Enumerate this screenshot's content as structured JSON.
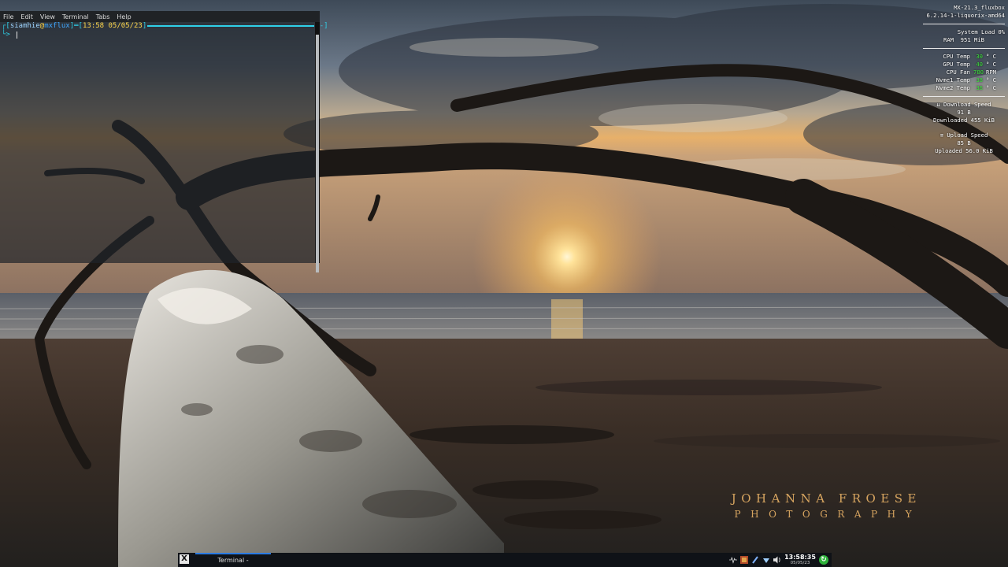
{
  "terminal": {
    "menu": [
      "File",
      "Edit",
      "View",
      "Terminal",
      "Tabs",
      "Help"
    ],
    "prompt": {
      "user": "siamhie",
      "at": "@",
      "host": "mxflux",
      "time": "13:58",
      "date": "05/05/23",
      "dash_marker": "[-]"
    }
  },
  "conky": {
    "distro": "MX-21.3_fluxbox",
    "kernel": "6.2.14-1-liquorix-amd64",
    "system_load": {
      "label": "System Load",
      "value": "0%"
    },
    "ram": {
      "label": "RAM",
      "value": "951 MiB"
    },
    "sensors": [
      {
        "label": "CPU Temp",
        "value": "30",
        "unit": "° C"
      },
      {
        "label": "GPU Temp",
        "value": "40",
        "unit": "° C"
      },
      {
        "label": "CPU Fan",
        "value": "780",
        "unit": "RPM"
      },
      {
        "label": "Nvme1 Temp",
        "value": "38",
        "unit": "° C"
      },
      {
        "label": "Nvme2 Temp",
        "value": "36",
        "unit": "° C"
      }
    ],
    "download": {
      "title": "Download Speed",
      "speed": "91 B",
      "total_label": "Downloaded",
      "total": "455 KiB"
    },
    "upload": {
      "title": "Upload Speed",
      "speed": "85 B",
      "total_label": "Uploaded",
      "total": "56.0 KiB"
    }
  },
  "watermark": {
    "line1": "JOHANNA FROESE",
    "line2": "PHOTOGRAPHY"
  },
  "taskbar": {
    "task_label": "Terminal -",
    "clock_time": "13:58:35",
    "clock_date": "05/05/23",
    "tray_icons": [
      "pulse-icon",
      "keyboard-layout-icon",
      "clipboard-icon",
      "network-icon",
      "volume-icon"
    ]
  },
  "colors": {
    "accent": "#2a7be4",
    "conky_value": "#3ee83e",
    "watermark": "#d7a560"
  }
}
